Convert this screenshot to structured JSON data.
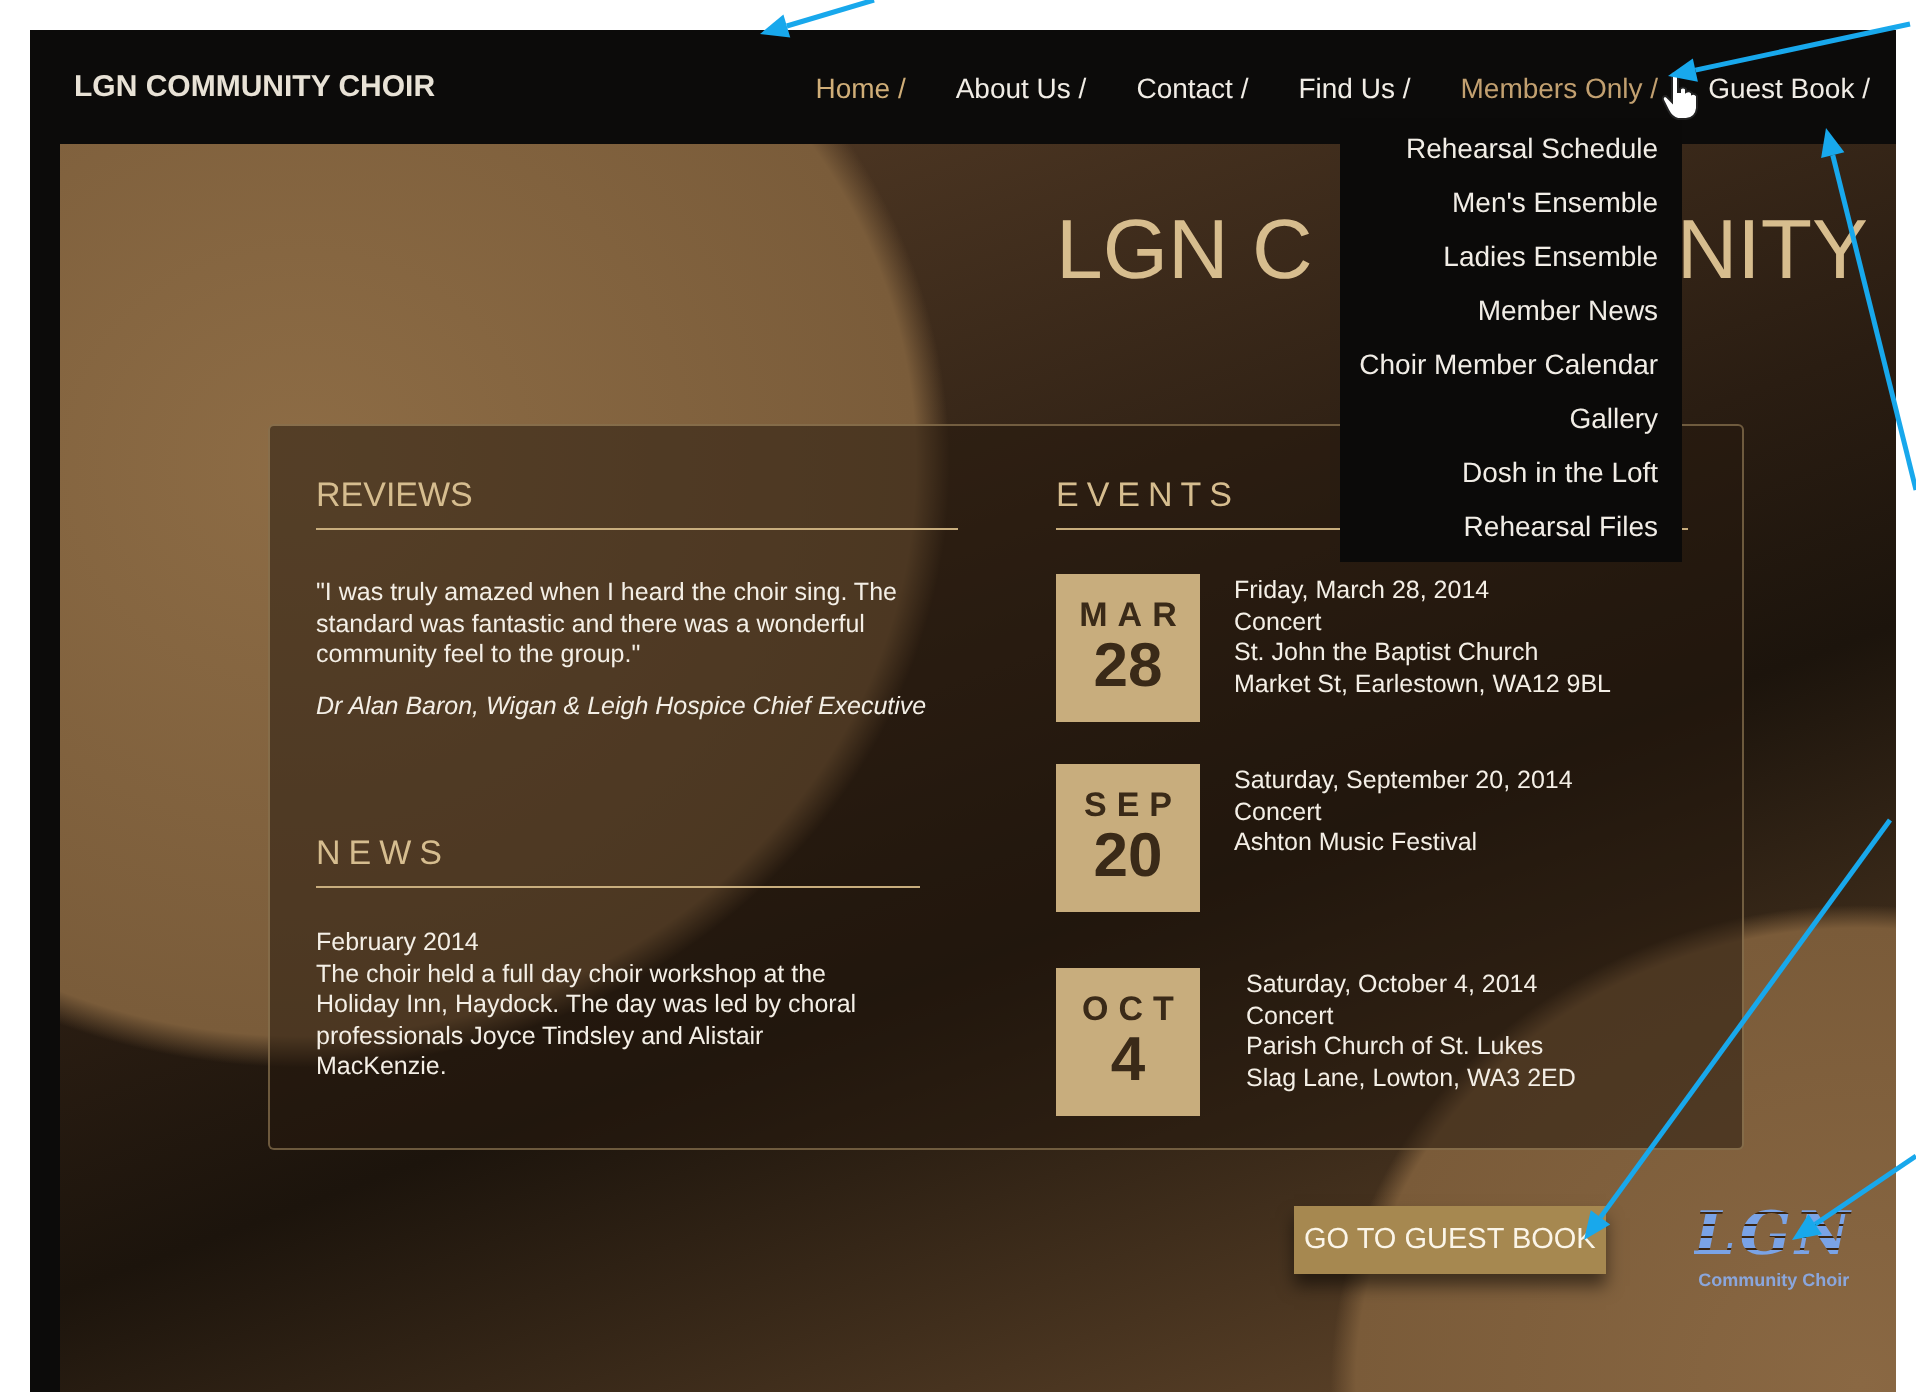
{
  "site": {
    "title": "LGN COMMUNITY CHOIR"
  },
  "nav": [
    {
      "label": "Home /",
      "selected": true,
      "expanded": false
    },
    {
      "label": "About Us /",
      "selected": false,
      "expanded": false
    },
    {
      "label": "Contact /",
      "selected": false,
      "expanded": false
    },
    {
      "label": "Find Us /",
      "selected": false,
      "expanded": false
    },
    {
      "label": "Members Only /",
      "selected": false,
      "expanded": true,
      "children": [
        "Rehearsal Schedule",
        "Men's Ensemble",
        "Ladies Ensemble",
        "Member News",
        "Choir Member Calendar",
        "Gallery",
        "Dosh in the Loft",
        "Rehearsal Files"
      ]
    },
    {
      "label": "Guest Book /",
      "selected": false,
      "expanded": false
    }
  ],
  "hero": {
    "title_left": "LGN C",
    "title_right": "NITY"
  },
  "reviews": {
    "heading": "REVIEWS",
    "quote": "\"I was truly amazed when I heard the choir sing. The standard was fantastic and there was a wonderful community feel to the group.\"",
    "attribution": "Dr Alan Baron, Wigan & Leigh Hospice Chief Executive"
  },
  "news": {
    "heading": "NEWS",
    "date": "February 2014",
    "body": "The choir held a full day choir workshop at the Holiday Inn, Haydock. The day was led by choral professionals Joyce Tindsley and Alistair MacKenzie."
  },
  "events": {
    "heading": "EVENTS",
    "items": [
      {
        "month": "MAR",
        "day": "28",
        "lines": [
          "Friday, March 28, 2014",
          "Concert",
          "St. John the Baptist Church",
          "Market St, Earlestown, WA12 9BL"
        ]
      },
      {
        "month": "SEP",
        "day": "20",
        "lines": [
          "Saturday, September 20, 2014",
          "Concert",
          "Ashton Music Festival"
        ]
      },
      {
        "month": "OCT",
        "day": "4",
        "lines": [
          "Saturday, October 4, 2014",
          "Concert",
          "Parish Church of St. Lukes",
          "Slag Lane, Lowton, WA3 2ED"
        ]
      }
    ]
  },
  "footer": {
    "button": "GO TO GUEST BOOK",
    "logo_text": "LGN",
    "logo_subtitle": "Community Choir"
  }
}
